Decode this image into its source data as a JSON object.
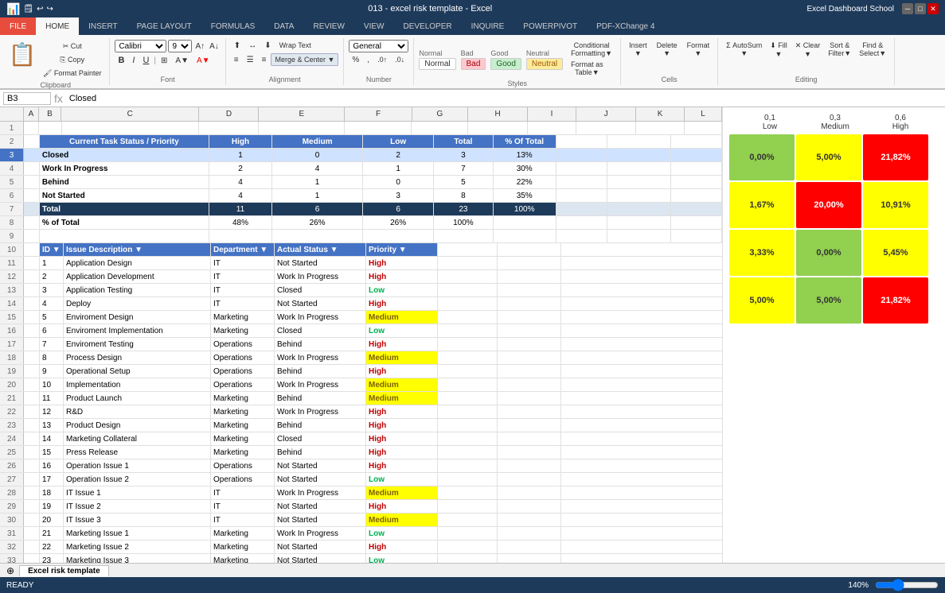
{
  "titleBar": {
    "title": "013 - excel risk template - Excel",
    "rightText": "Excel Dashboard School"
  },
  "ribbon": {
    "tabs": [
      "FILE",
      "HOME",
      "INSERT",
      "PAGE LAYOUT",
      "FORMULAS",
      "DATA",
      "REVIEW",
      "VIEW",
      "DEVELOPER",
      "INQUIRE",
      "POWERPIVOT",
      "PDF-XChange 4"
    ],
    "activeTab": "HOME",
    "groups": [
      {
        "label": "Clipboard",
        "buttons": [
          "✂ Cut",
          "⎘ Copy",
          "Format Painter"
        ]
      },
      {
        "label": "Font",
        "buttons": []
      },
      {
        "label": "Alignment",
        "buttons": [
          "Merge & Center"
        ]
      },
      {
        "label": "Number",
        "buttons": []
      },
      {
        "label": "Styles",
        "buttons": []
      },
      {
        "label": "Cells",
        "buttons": [
          "Insert",
          "Delete",
          "Format"
        ]
      },
      {
        "label": "Editing",
        "buttons": [
          "AutoSum",
          "Fill",
          "Clear",
          "Sort & Filter",
          "Find & Select"
        ]
      }
    ]
  },
  "formulaBar": {
    "cellRef": "B3",
    "formula": "Closed"
  },
  "columns": {
    "headers": [
      "",
      "A",
      "B",
      "C",
      "D",
      "E",
      "F",
      "G",
      "H",
      "I",
      "J",
      "K",
      "L"
    ]
  },
  "summaryTable": {
    "header": "Current Task Status / Priority",
    "colHeaders": [
      "",
      "High",
      "Medium",
      "Low",
      "Total",
      "% Of Total"
    ],
    "rows": [
      {
        "label": "Closed",
        "high": "1",
        "medium": "0",
        "low": "2",
        "total": "3",
        "pct": "13%"
      },
      {
        "label": "Work In Progress",
        "high": "2",
        "medium": "4",
        "low": "1",
        "total": "7",
        "pct": "30%"
      },
      {
        "label": "Behind",
        "high": "4",
        "medium": "1",
        "low": "0",
        "total": "5",
        "pct": "22%"
      },
      {
        "label": "Not Started",
        "high": "4",
        "medium": "1",
        "low": "3",
        "total": "8",
        "pct": "35%"
      },
      {
        "label": "Total",
        "high": "11",
        "medium": "6",
        "low": "6",
        "total": "23",
        "pct": "100%"
      },
      {
        "label": "% of Total",
        "high": "48%",
        "medium": "26%",
        "low": "26%",
        "total": "100%",
        "pct": ""
      }
    ]
  },
  "taskList": {
    "headers": [
      "ID",
      "Issue Description",
      "Department",
      "Actual Status",
      "Priority"
    ],
    "rows": [
      {
        "id": "1",
        "desc": "Application Design",
        "dept": "IT",
        "status": "Not Started",
        "priority": "High",
        "priorityType": "high"
      },
      {
        "id": "2",
        "desc": "Application Development",
        "dept": "IT",
        "status": "Work In Progress",
        "priority": "High",
        "priorityType": "high"
      },
      {
        "id": "3",
        "desc": "Application Testing",
        "dept": "IT",
        "status": "Closed",
        "priority": "Low",
        "priorityType": "low"
      },
      {
        "id": "4",
        "desc": "Deploy",
        "dept": "IT",
        "status": "Not Started",
        "priority": "High",
        "priorityType": "high"
      },
      {
        "id": "5",
        "desc": "Enviroment Design",
        "dept": "Marketing",
        "status": "Work In Progress",
        "priority": "Medium",
        "priorityType": "medium"
      },
      {
        "id": "6",
        "desc": "Enviroment Implementation",
        "dept": "Marketing",
        "status": "Closed",
        "priority": "Low",
        "priorityType": "low"
      },
      {
        "id": "7",
        "desc": "Enviroment Testing",
        "dept": "Operations",
        "status": "Behind",
        "priority": "High",
        "priorityType": "high"
      },
      {
        "id": "8",
        "desc": "Process Design",
        "dept": "Operations",
        "status": "Work In Progress",
        "priority": "Medium",
        "priorityType": "medium"
      },
      {
        "id": "9",
        "desc": "Operational Setup",
        "dept": "Operations",
        "status": "Behind",
        "priority": "High",
        "priorityType": "high"
      },
      {
        "id": "10",
        "desc": "Implementation",
        "dept": "Operations",
        "status": "Work In Progress",
        "priority": "Medium",
        "priorityType": "medium"
      },
      {
        "id": "11",
        "desc": "Product Launch",
        "dept": "Marketing",
        "status": "Behind",
        "priority": "Medium",
        "priorityType": "medium"
      },
      {
        "id": "12",
        "desc": "R&D",
        "dept": "Marketing",
        "status": "Work In Progress",
        "priority": "High",
        "priorityType": "high"
      },
      {
        "id": "13",
        "desc": "Product Design",
        "dept": "Marketing",
        "status": "Behind",
        "priority": "High",
        "priorityType": "high"
      },
      {
        "id": "14",
        "desc": "Marketing Collateral",
        "dept": "Marketing",
        "status": "Closed",
        "priority": "High",
        "priorityType": "high"
      },
      {
        "id": "15",
        "desc": "Press Release",
        "dept": "Marketing",
        "status": "Behind",
        "priority": "High",
        "priorityType": "high"
      },
      {
        "id": "16",
        "desc": "Operation Issue 1",
        "dept": "Operations",
        "status": "Not Started",
        "priority": "High",
        "priorityType": "high"
      },
      {
        "id": "17",
        "desc": "Operation Issue 2",
        "dept": "Operations",
        "status": "Not Started",
        "priority": "Low",
        "priorityType": "low"
      },
      {
        "id": "18",
        "desc": "IT Issue 1",
        "dept": "IT",
        "status": "Work In Progress",
        "priority": "Medium",
        "priorityType": "medium"
      },
      {
        "id": "19",
        "desc": "IT Issue 2",
        "dept": "IT",
        "status": "Not Started",
        "priority": "High",
        "priorityType": "high"
      },
      {
        "id": "20",
        "desc": "IT Issue 3",
        "dept": "IT",
        "status": "Not Started",
        "priority": "Medium",
        "priorityType": "medium"
      },
      {
        "id": "21",
        "desc": "Marketing Issue 1",
        "dept": "Marketing",
        "status": "Work In Progress",
        "priority": "Low",
        "priorityType": "low"
      },
      {
        "id": "22",
        "desc": "Marketing Issue 2",
        "dept": "Marketing",
        "status": "Not Started",
        "priority": "High",
        "priorityType": "high"
      },
      {
        "id": "23",
        "desc": "Marketing Issue 3",
        "dept": "Marketing",
        "status": "Not Started",
        "priority": "Low",
        "priorityType": "low"
      }
    ]
  },
  "matrix": {
    "colHeaders": [
      "0,1\nLow",
      "0,3\nMedium",
      "0,6\nHigh"
    ],
    "rows": [
      {
        "cells": [
          {
            "value": "0,00%",
            "type": "green"
          },
          {
            "value": "5,00%",
            "type": "yellow"
          },
          {
            "value": "21,82%",
            "type": "red"
          }
        ]
      },
      {
        "cells": [
          {
            "value": "1,67%",
            "type": "yellow"
          },
          {
            "value": "20,00%",
            "type": "red"
          },
          {
            "value": "10,91%",
            "type": "yellow"
          }
        ]
      },
      {
        "cells": [
          {
            "value": "3,33%",
            "type": "yellow"
          },
          {
            "value": "0,00%",
            "type": "green"
          },
          {
            "value": "5,45%",
            "type": "yellow"
          }
        ]
      },
      {
        "cells": [
          {
            "value": "5,00%",
            "type": "yellow"
          },
          {
            "value": "5,00%",
            "type": "green"
          },
          {
            "value": "21,82%",
            "type": "red"
          }
        ]
      }
    ]
  },
  "statusBar": {
    "ready": "READY",
    "zoom": "140%"
  },
  "sheetTab": "Excel risk template",
  "styles": {
    "normal": "Normal",
    "bad": "Bad",
    "good": "Good",
    "neutral": "Neutral"
  }
}
